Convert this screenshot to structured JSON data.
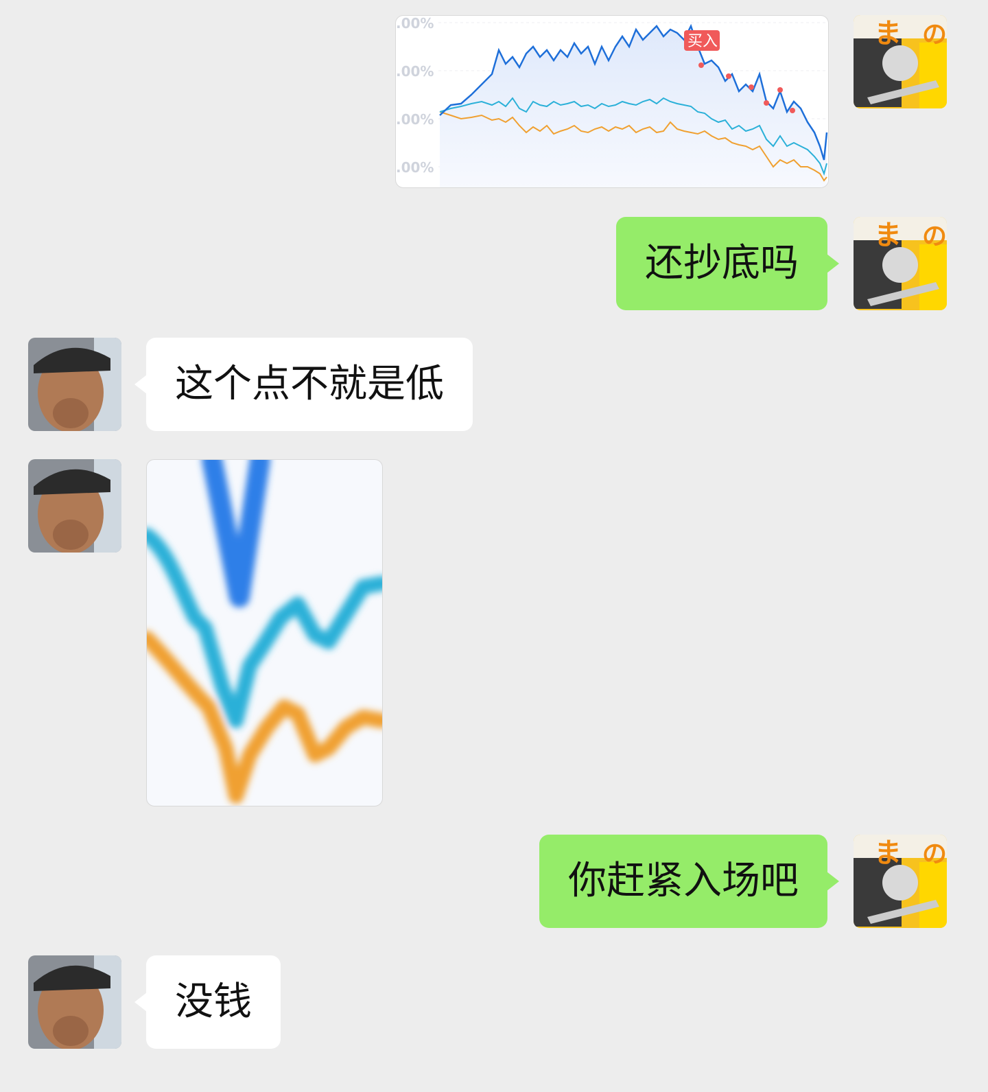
{
  "messages": [
    {
      "side": "right",
      "type": "image",
      "content": "fund-performance-chart"
    },
    {
      "side": "right",
      "type": "text",
      "text": "还抄底吗"
    },
    {
      "side": "left",
      "type": "text",
      "text": "这个点不就是低"
    },
    {
      "side": "left",
      "type": "image",
      "content": "zoomed-chart-crop"
    },
    {
      "side": "right",
      "type": "text",
      "text": "你赶紧入场吧"
    },
    {
      "side": "left",
      "type": "text",
      "text": "没钱"
    }
  ],
  "chart": {
    "y_tick_labels": [
      ".00%",
      ".00%",
      ".00%",
      ".00%"
    ],
    "buy_marker_label": "买入",
    "colors": {
      "blue": "#1e6fd9",
      "cyan": "#2ab0d8",
      "orange": "#f0a030",
      "buy": "#f05a5a"
    }
  },
  "colors": {
    "background": "#ededed",
    "outgoing_bubble": "#95ec69",
    "incoming_bubble": "#ffffff"
  }
}
